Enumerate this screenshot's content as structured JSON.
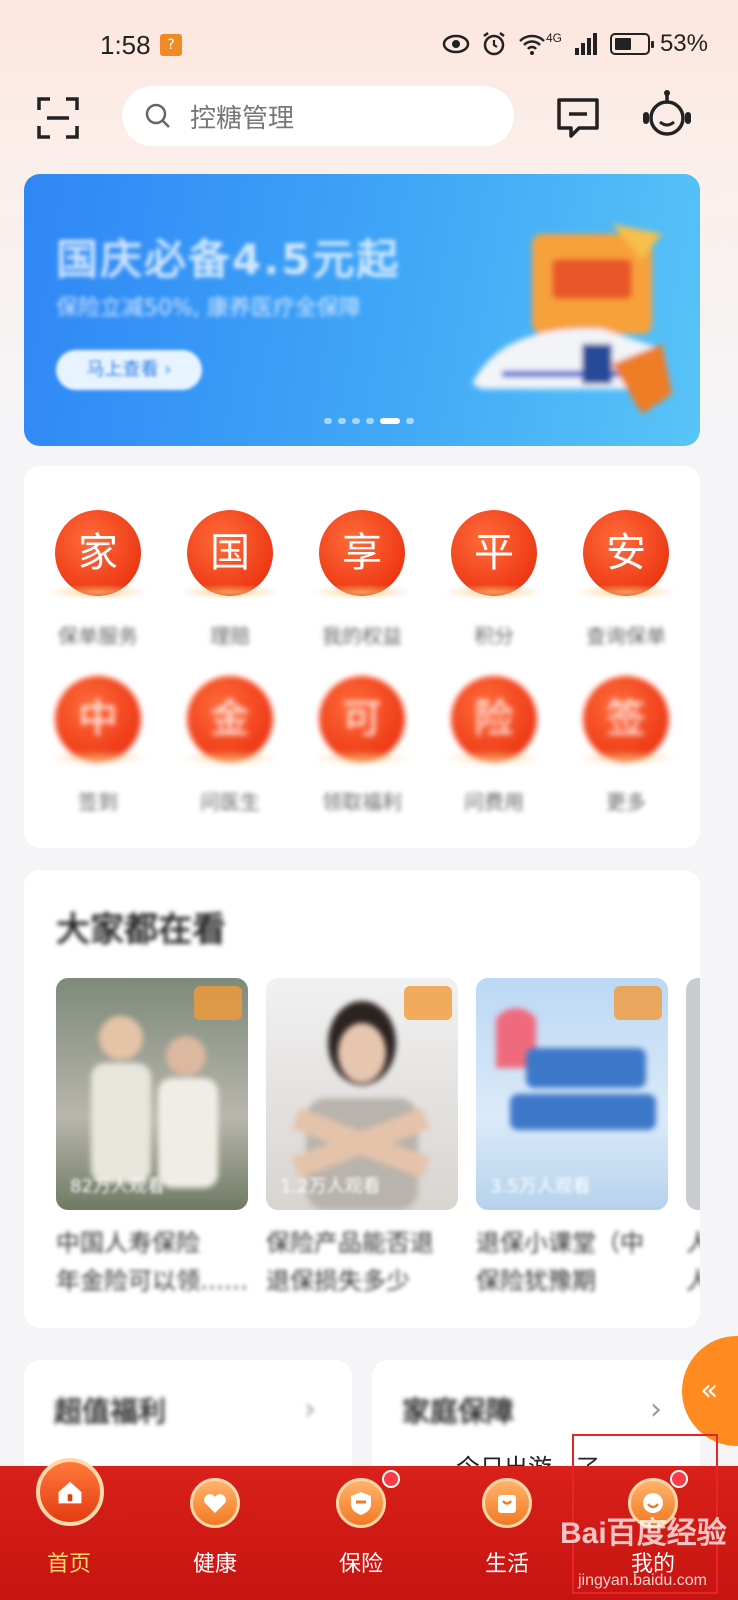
{
  "status_bar": {
    "time": "1:58",
    "network": "4G",
    "battery": "53%"
  },
  "header": {
    "search_placeholder": "控糖管理"
  },
  "banner": {
    "title": "国庆必备4.5元起",
    "subtitle": "保险立减50%, 康养医疗全保障",
    "button": "马上查看 ›",
    "accent": "#3a97f6"
  },
  "service_grid": {
    "row1": [
      {
        "char": "家",
        "label": "保单服务"
      },
      {
        "char": "国",
        "label": "理赔"
      },
      {
        "char": "享",
        "label": "我的权益"
      },
      {
        "char": "平",
        "label": "积分"
      },
      {
        "char": "安",
        "label": "查询保单"
      }
    ],
    "row2": [
      {
        "char": "中",
        "label": "签到"
      },
      {
        "char": "金",
        "label": "问医生"
      },
      {
        "char": "可",
        "label": "领取福利"
      },
      {
        "char": "险",
        "label": "问费用"
      },
      {
        "char": "签",
        "label": "更多"
      }
    ]
  },
  "videos": {
    "title": "大家都在看",
    "items": [
      {
        "meta": "82万人观看",
        "caption_line1": "中国人寿保险",
        "caption_line2": "年金险可以领……"
      },
      {
        "meta": "1.2万人观看",
        "caption_line1": "保险产品能否退",
        "caption_line2": "退保损失多少"
      },
      {
        "meta": "3.5万人观看",
        "caption_line1": "退保小课堂（中",
        "caption_line2": "保险犹豫期"
      },
      {
        "meta": "",
        "caption_line1": "人",
        "caption_line2": "人"
      }
    ]
  },
  "bottom_cards": {
    "left_title": "超值福利",
    "right_title": "家庭保障",
    "peek_text": "今日出游，了"
  },
  "float_button": "«",
  "tabbar": {
    "tabs": [
      {
        "label": "首页",
        "active": true
      },
      {
        "label": "健康"
      },
      {
        "label": "保险"
      },
      {
        "label": "生活"
      },
      {
        "label": "我的"
      }
    ],
    "active_color": "#ffd76e",
    "bar_color": "#d11a15"
  },
  "watermark": {
    "brand": "Bai百度经验",
    "url": "jingyan.baidu.com"
  }
}
